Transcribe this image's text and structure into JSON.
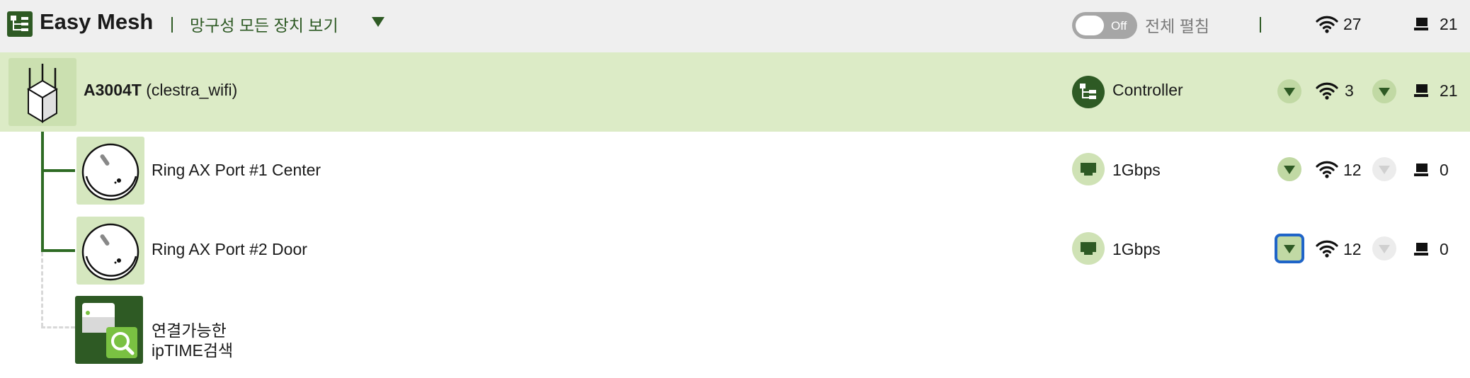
{
  "header": {
    "app_title": "Easy Mesh",
    "view_select": "망구성 모든 장치 보기",
    "toggle_state": "Off",
    "expand_all_label": "전체 펼침",
    "wifi_total": "27",
    "wired_total": "21"
  },
  "controller": {
    "model": "A3004T",
    "ssid": "(clestra_wifi)",
    "role": "Controller",
    "wifi_count": "3",
    "wired_count": "21"
  },
  "agents": [
    {
      "name": "Ring AX Port #1 Center",
      "link_speed": "1Gbps",
      "wifi_count": "12",
      "wired_count": "0"
    },
    {
      "name": "Ring AX Port #2 Door",
      "link_speed": "1Gbps",
      "wifi_count": "12",
      "wired_count": "0"
    }
  ],
  "search_item": {
    "line1": "연결가능한",
    "line2": "ipTIME검색"
  },
  "icons": {
    "logo": "mesh-tree-icon",
    "view_dropdown": "chevron-down-icon",
    "wifi": "wifi-icon",
    "wired": "pc-icon",
    "controller_device": "router-antenna-icon",
    "agent_device": "ring-ap-icon",
    "role": "network-tree-icon",
    "link": "ethernet-icon",
    "search": "magnifier-icon"
  },
  "colors": {
    "brand_green": "#2e5a24",
    "controller_row_bg": "#dcebc6",
    "header_bg": "#efefef",
    "focus_ring": "#1f64c8"
  }
}
